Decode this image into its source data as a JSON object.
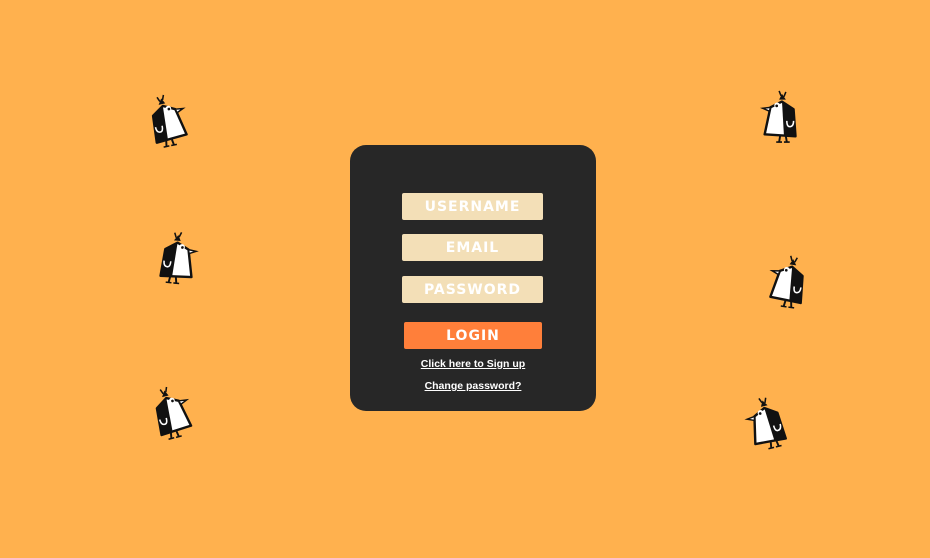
{
  "colors": {
    "background": "#FFB14E",
    "card": "#272727",
    "field": "#F3DFB7",
    "button": "#FF7F3A",
    "text": "#FFFFFF"
  },
  "decorations": {
    "icon": "penguin-icon"
  },
  "form": {
    "username_placeholder": "USERNAME",
    "email_placeholder": "EMAIL",
    "password_placeholder": "PASSWORD",
    "login_label": "LOGIN",
    "signup_link": "Click here to Sign up",
    "change_password_link": "Change password?"
  }
}
